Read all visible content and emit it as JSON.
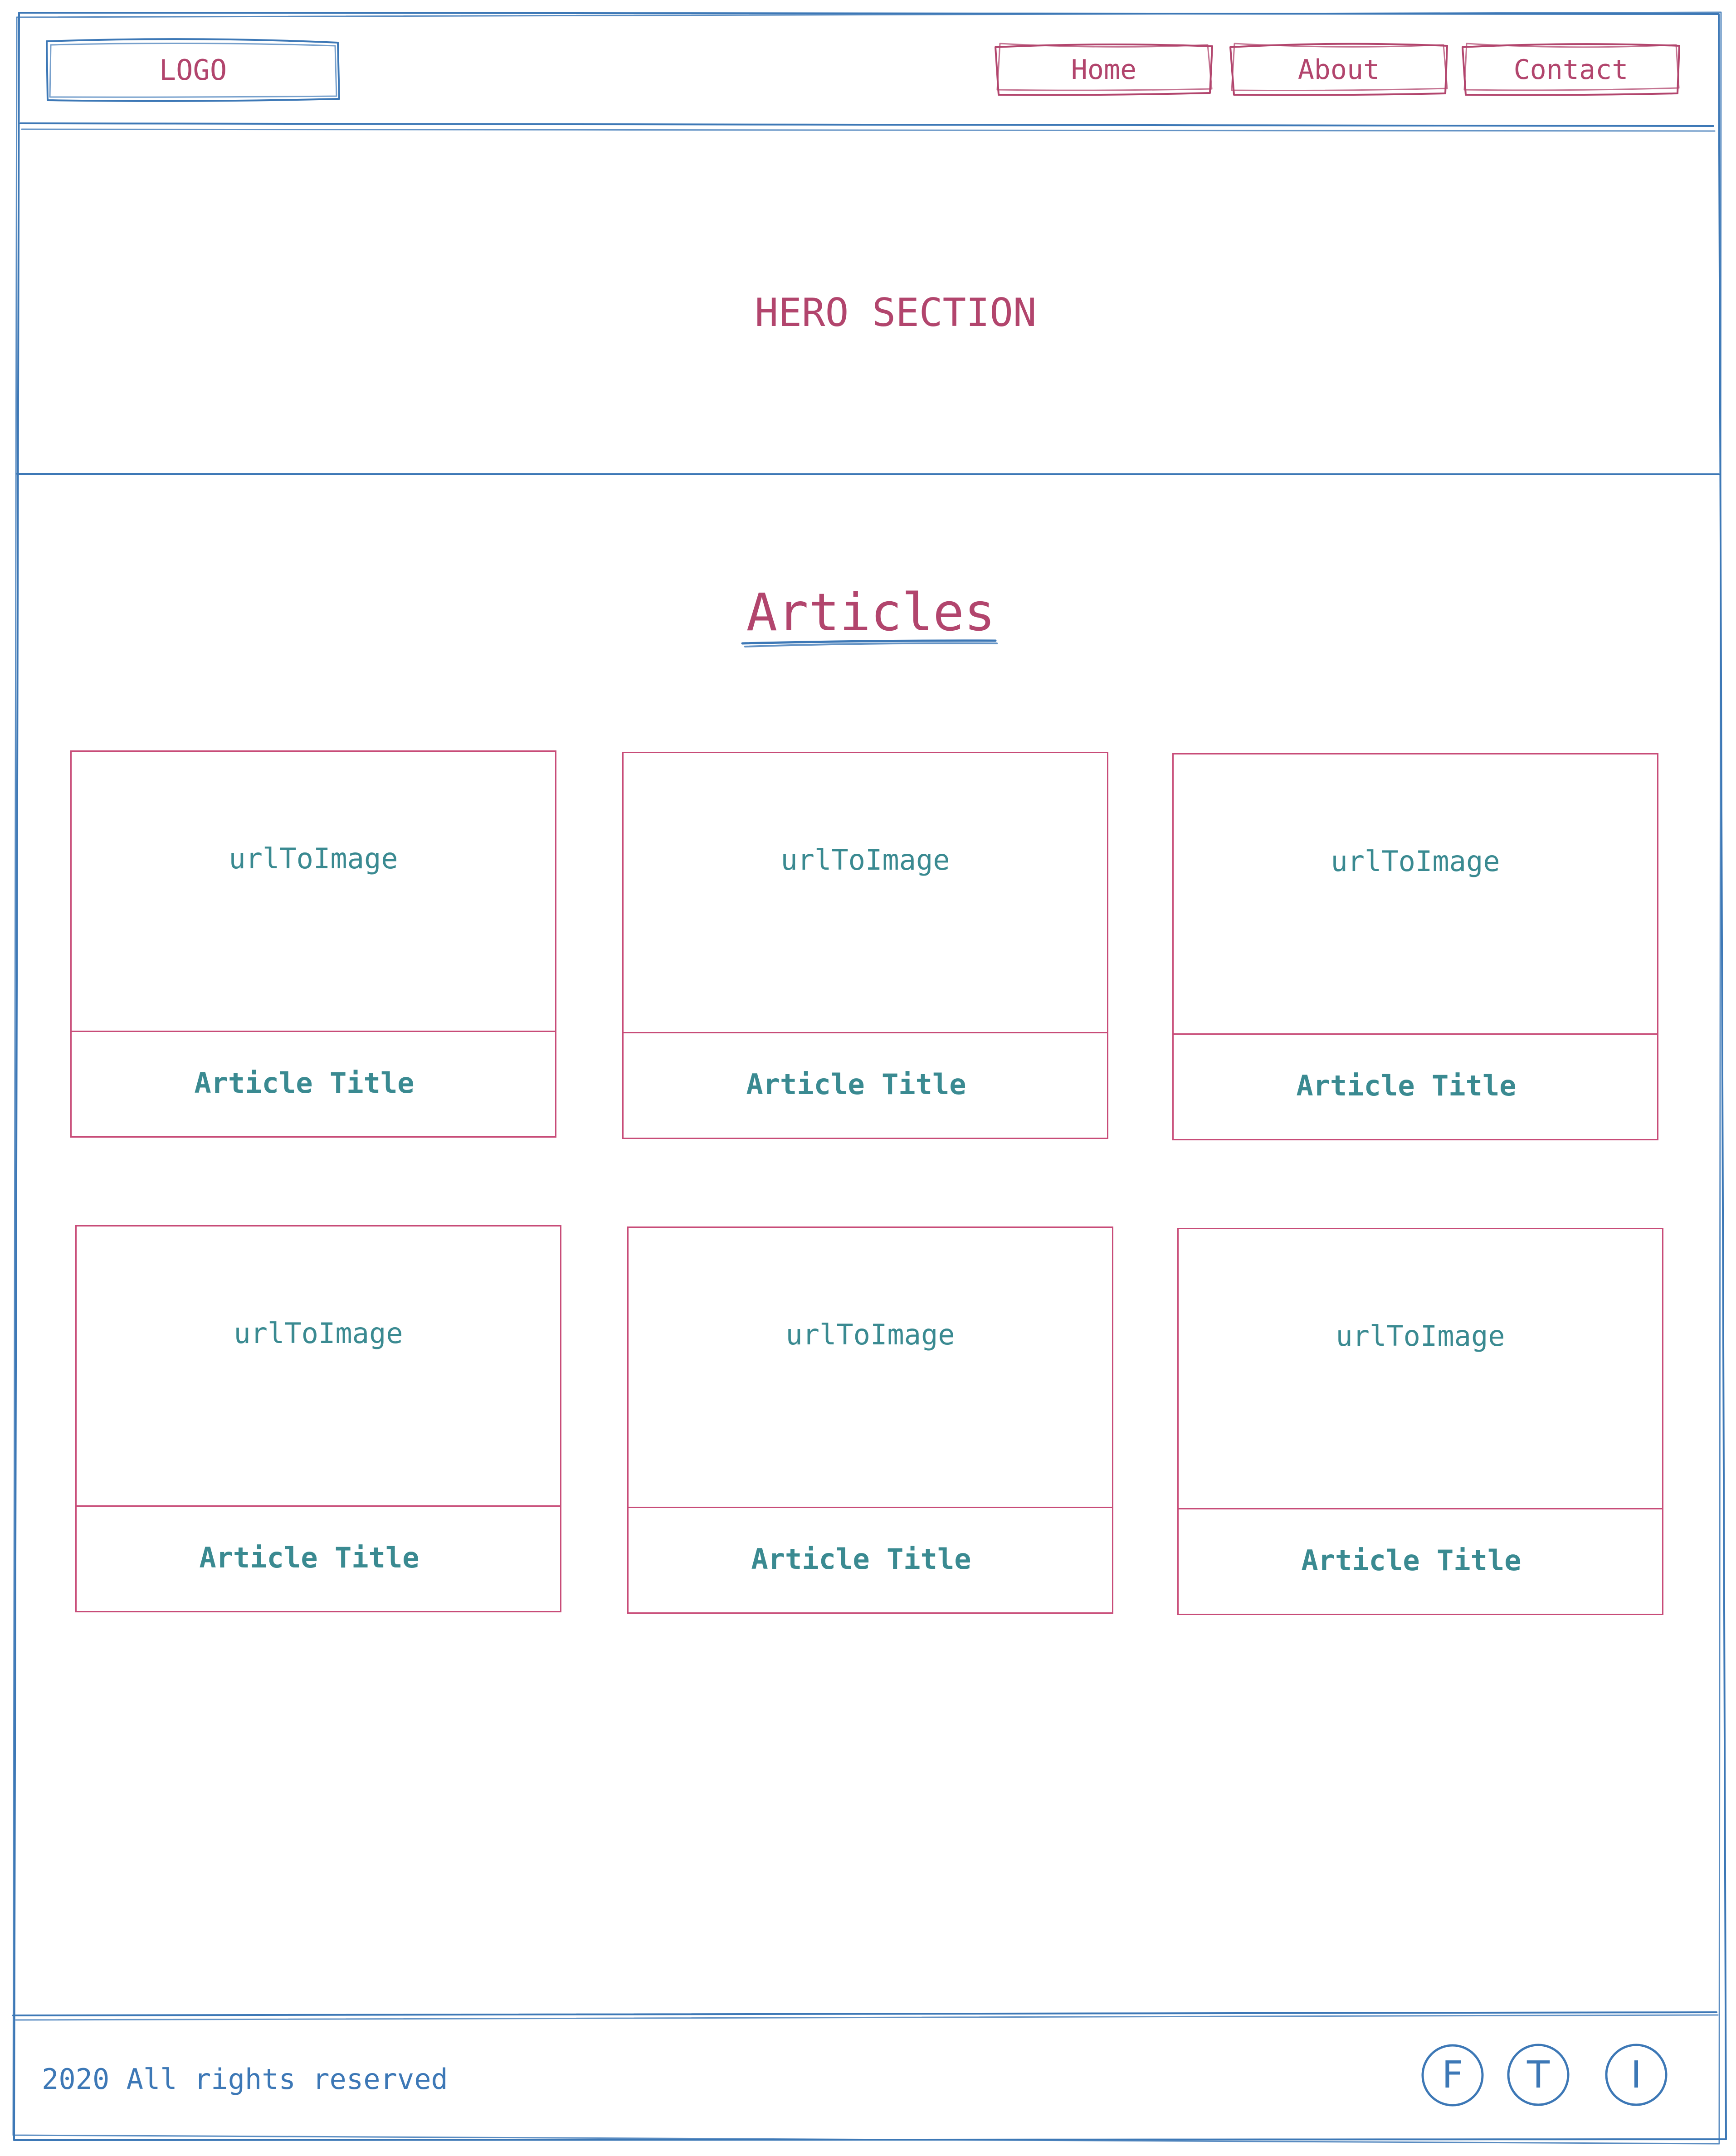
{
  "header": {
    "logo": "LOGO",
    "nav": {
      "home": "Home",
      "about": "About",
      "contact": "Contact"
    }
  },
  "hero": {
    "title": "HERO SECTION"
  },
  "articles": {
    "heading": "Articles",
    "cards": [
      {
        "image": "urlToImage",
        "title": "Article Title"
      },
      {
        "image": "urlToImage",
        "title": "Article Title"
      },
      {
        "image": "urlToImage",
        "title": "Article Title"
      },
      {
        "image": "urlToImage",
        "title": "Article Title"
      },
      {
        "image": "urlToImage",
        "title": "Article Title"
      },
      {
        "image": "urlToImage",
        "title": "Article Title"
      }
    ]
  },
  "footer": {
    "copyright": "2020 All rights reserved",
    "social": {
      "facebook": "F",
      "twitter": "T",
      "instagram": "I"
    }
  },
  "colors": {
    "frame": "#3d78b6",
    "accent": "#b2456d",
    "card_text": "#3a8a91"
  }
}
